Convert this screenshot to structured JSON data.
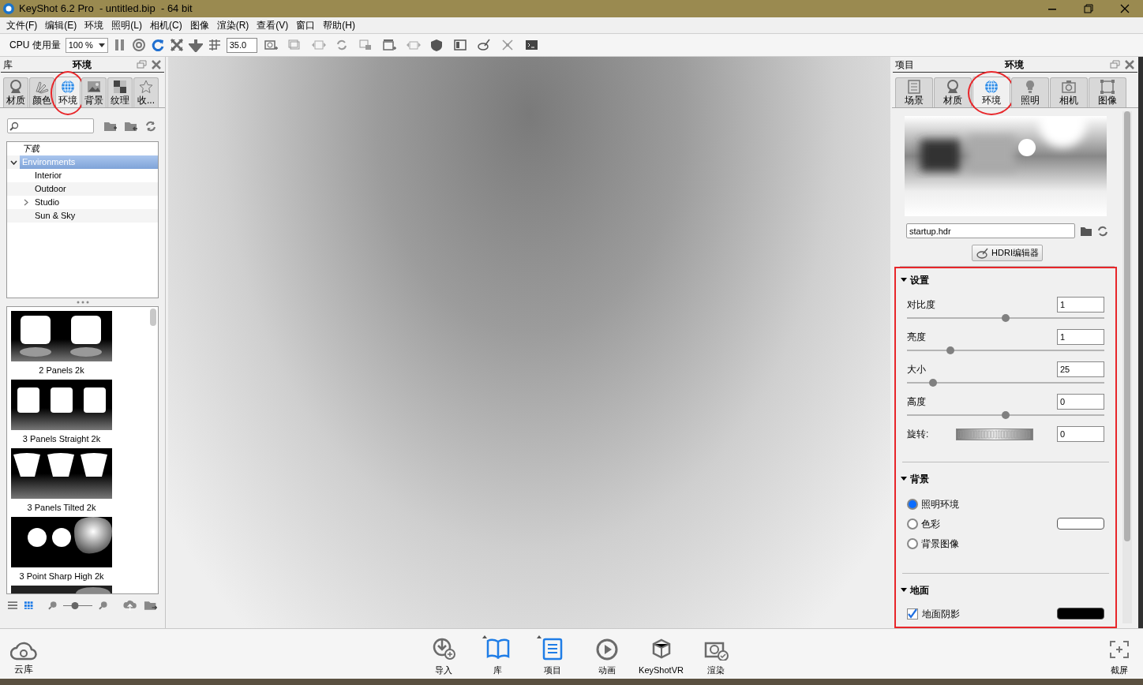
{
  "window": {
    "title": "KeyShot 6.2 Pro  - untitled.bip  - 64 bit"
  },
  "menu": [
    "文件(F)",
    "编辑(E)",
    "环境",
    "照明(L)",
    "相机(C)",
    "图像",
    "渲染(R)",
    "查看(V)",
    "窗口",
    "帮助(H)"
  ],
  "toolbar": {
    "cpu_label": "CPU 使用量",
    "cpu_select": "100 %",
    "fov_value": "35.0"
  },
  "library_panel": {
    "title": "库",
    "heading": "环境",
    "tabs": [
      {
        "label": "材质",
        "selected": false,
        "circled": false
      },
      {
        "label": "颜色",
        "selected": false,
        "circled": false
      },
      {
        "label": "环境",
        "selected": true,
        "circled": true
      },
      {
        "label": "背景",
        "selected": false,
        "circled": false
      },
      {
        "label": "纹理",
        "selected": false,
        "circled": false
      },
      {
        "label": "收...",
        "selected": false,
        "circled": false
      }
    ],
    "tree": [
      {
        "label": "下载",
        "selected": false
      },
      {
        "label": "Environments",
        "selected": true,
        "expanded": true,
        "children": [
          {
            "label": "Interior",
            "selected": false
          },
          {
            "label": "Outdoor",
            "selected": false
          },
          {
            "label": "Studio",
            "selected": false,
            "expanded": false
          },
          {
            "label": "Sun & Sky",
            "selected": false
          }
        ]
      }
    ],
    "thumbnails": [
      {
        "kind": "two-panels",
        "caption": "2 Panels 2k"
      },
      {
        "kind": "three-panels",
        "caption": "3 Panels Straight 2k"
      },
      {
        "kind": "tilted-panels",
        "caption": "3 Panels Tilted 2k"
      },
      {
        "kind": "point-lights",
        "caption": "3 Point Sharp High 2k"
      },
      {
        "kind": "partial"
      }
    ],
    "thumb_size": {
      "level": 0.4
    }
  },
  "project_panel": {
    "title": "项目",
    "heading": "环境",
    "tabs": [
      {
        "label": "场景",
        "selected": false,
        "circled": false
      },
      {
        "label": "材质",
        "selected": false,
        "circled": false
      },
      {
        "label": "环境",
        "selected": true,
        "circled": true
      },
      {
        "label": "照明",
        "selected": false,
        "circled": false
      },
      {
        "label": "相机",
        "selected": false,
        "circled": false
      },
      {
        "label": "图像",
        "selected": false,
        "circled": false
      }
    ],
    "hdr_file": "startup.hdr",
    "hdri_button": "HDRI编辑器",
    "highlight_frame": true,
    "settings": {
      "title": "设置",
      "expanded": true,
      "params": [
        {
          "kind": "slider",
          "label": "对比度",
          "value": "1",
          "level": 0.5
        },
        {
          "kind": "slider",
          "label": "亮度",
          "value": "1",
          "level": 0.22
        },
        {
          "kind": "slider",
          "label": "大小",
          "value": "25",
          "level": 0.13
        },
        {
          "kind": "slider",
          "label": "高度",
          "value": "0",
          "level": 0.5
        },
        {
          "kind": "dial",
          "label": "旋转:",
          "value": "0"
        }
      ]
    },
    "background": {
      "title": "背景",
      "expanded": true,
      "options": [
        {
          "label": "照明环境",
          "selected": true
        },
        {
          "label": "色彩",
          "selected": false,
          "color": "#ffffff"
        },
        {
          "label": "背景图像",
          "selected": false
        }
      ]
    },
    "ground": {
      "title": "地面",
      "expanded": true,
      "options": [
        {
          "label": "地面阴影",
          "checked": true,
          "color": "#000000"
        }
      ]
    }
  },
  "bottom_bar": {
    "cloud_label": "云库",
    "buttons": [
      {
        "label": "导入",
        "selected": false
      },
      {
        "label": "库",
        "selected": true
      },
      {
        "label": "项目",
        "selected": true
      },
      {
        "label": "动画",
        "selected": false
      },
      {
        "label": "KeyShotVR",
        "selected": false
      },
      {
        "label": "渲染",
        "selected": false
      }
    ],
    "screenshot_label": "截屏"
  }
}
